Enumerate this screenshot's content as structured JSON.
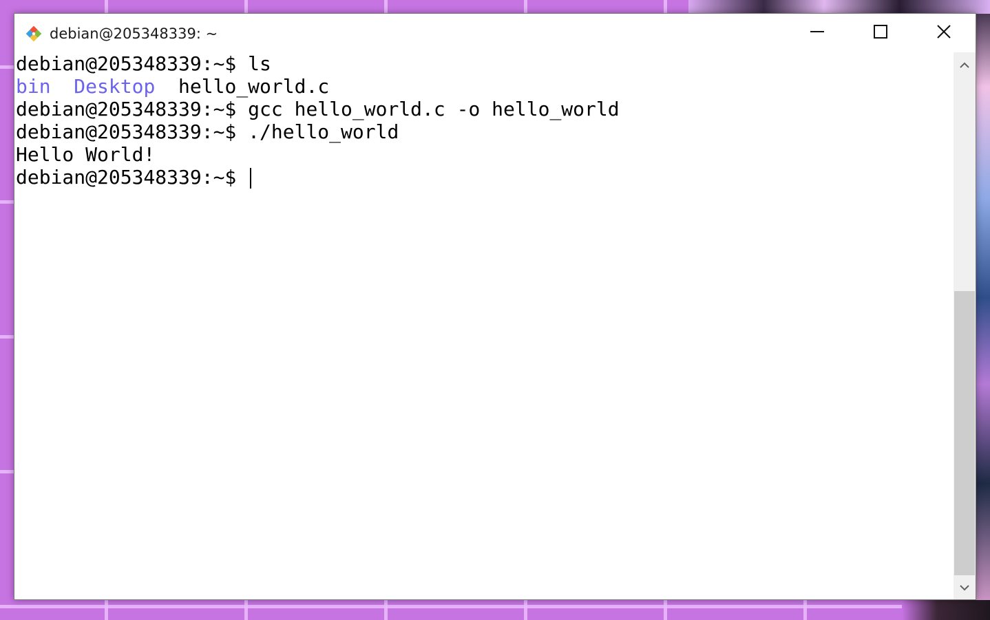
{
  "window": {
    "title": "debian@205348339: ~",
    "app_icon": "git-bash-icon",
    "controls": {
      "minimize_icon": "minimize-icon",
      "maximize_icon": "maximize-icon",
      "close_icon": "close-icon"
    }
  },
  "terminal": {
    "prompt": "debian@205348339:~$ ",
    "lines": [
      {
        "prompt": "debian@205348339:~$ ",
        "command": "ls"
      },
      {
        "dirs": [
          "bin",
          "Desktop"
        ],
        "file": "hello_world.c"
      },
      {
        "prompt": "debian@205348339:~$ ",
        "command": "gcc hello_world.c -o hello_world"
      },
      {
        "prompt": "debian@205348339:~$ ",
        "command": "./hello_world"
      },
      {
        "output": "Hello World!"
      },
      {
        "prompt": "debian@205348339:~$ ",
        "command": ""
      }
    ],
    "colors": {
      "background": "#ffffff",
      "foreground": "#000000",
      "directory": "#6b63ee"
    }
  },
  "scrollbar": {
    "up_icon": "chevron-up-icon",
    "down_icon": "chevron-down-icon",
    "thumb_position": 0.44
  }
}
